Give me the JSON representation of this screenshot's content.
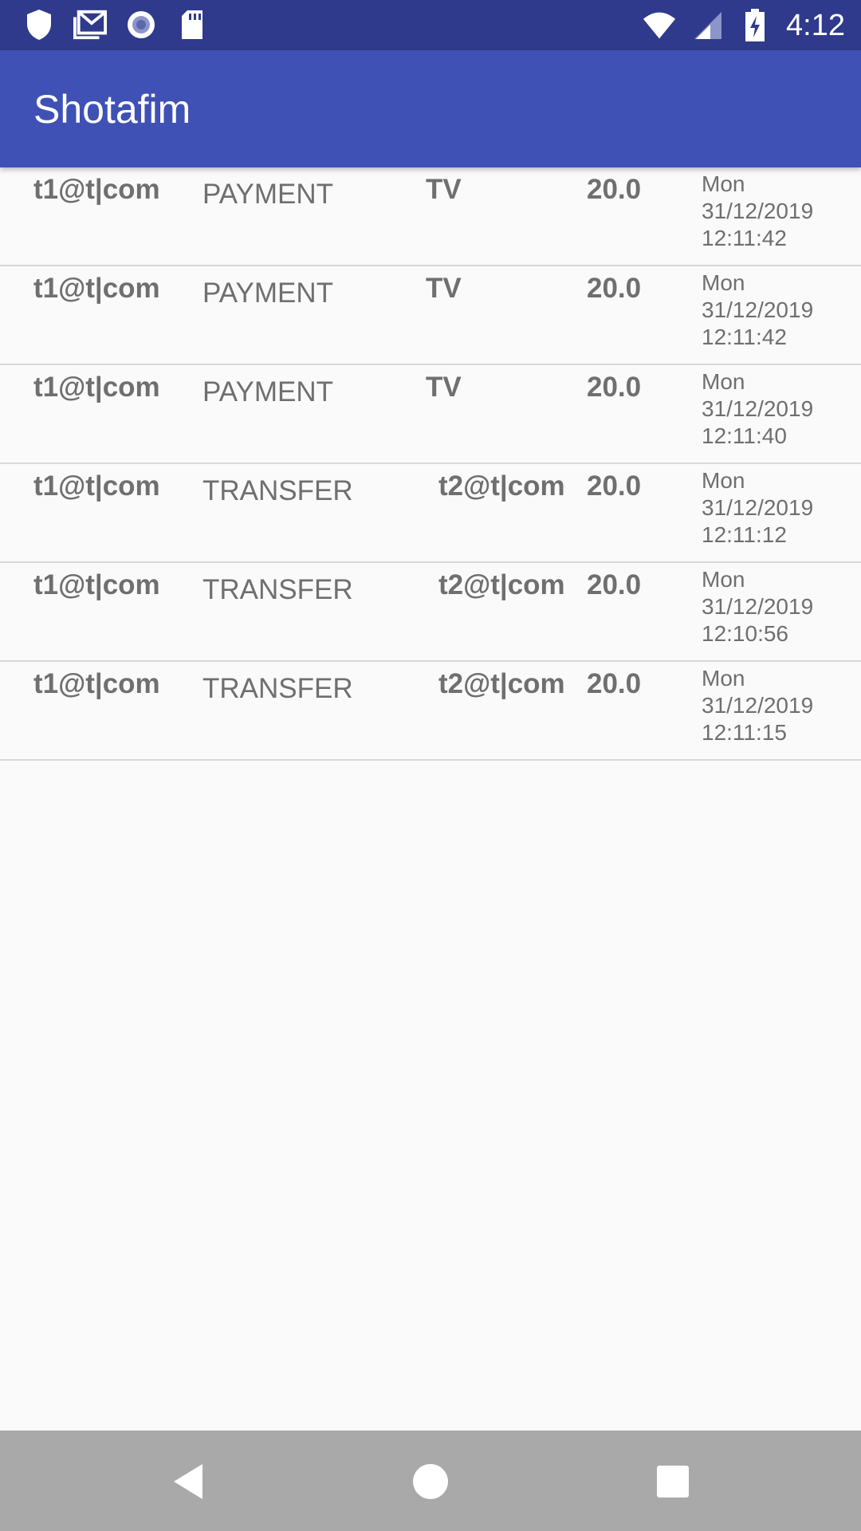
{
  "status_bar": {
    "time": "4:12",
    "left_icons": [
      "shield-icon",
      "gmail-icon",
      "record-icon",
      "sd-card-icon"
    ],
    "right_icons": [
      "wifi-icon",
      "signal-icon",
      "battery-charging-icon"
    ]
  },
  "app_bar": {
    "title": "Shotafim"
  },
  "transactions": [
    {
      "user": "t1@t|com",
      "type": "PAYMENT",
      "target": "TV",
      "amount": "20.0",
      "day": "Mon",
      "date": "31/12/2019",
      "time": "12:11:42"
    },
    {
      "user": "t1@t|com",
      "type": "PAYMENT",
      "target": "TV",
      "amount": "20.0",
      "day": "Mon",
      "date": "31/12/2019",
      "time": "12:11:42"
    },
    {
      "user": "t1@t|com",
      "type": "PAYMENT",
      "target": "TV",
      "amount": "20.0",
      "day": "Mon",
      "date": "31/12/2019",
      "time": "12:11:40"
    },
    {
      "user": "t1@t|com",
      "type": "TRANSFER",
      "target": "t2@t|com",
      "amount": "20.0",
      "day": "Mon",
      "date": "31/12/2019",
      "time": "12:11:12"
    },
    {
      "user": "t1@t|com",
      "type": "TRANSFER",
      "target": "t2@t|com",
      "amount": "20.0",
      "day": "Mon",
      "date": "31/12/2019",
      "time": "12:10:56"
    },
    {
      "user": "t1@t|com",
      "type": "TRANSFER",
      "target": "t2@t|com",
      "amount": "20.0",
      "day": "Mon",
      "date": "31/12/2019",
      "time": "12:11:15"
    }
  ],
  "nav_bar": {
    "icons": [
      "back-icon",
      "home-icon",
      "recents-icon"
    ]
  }
}
